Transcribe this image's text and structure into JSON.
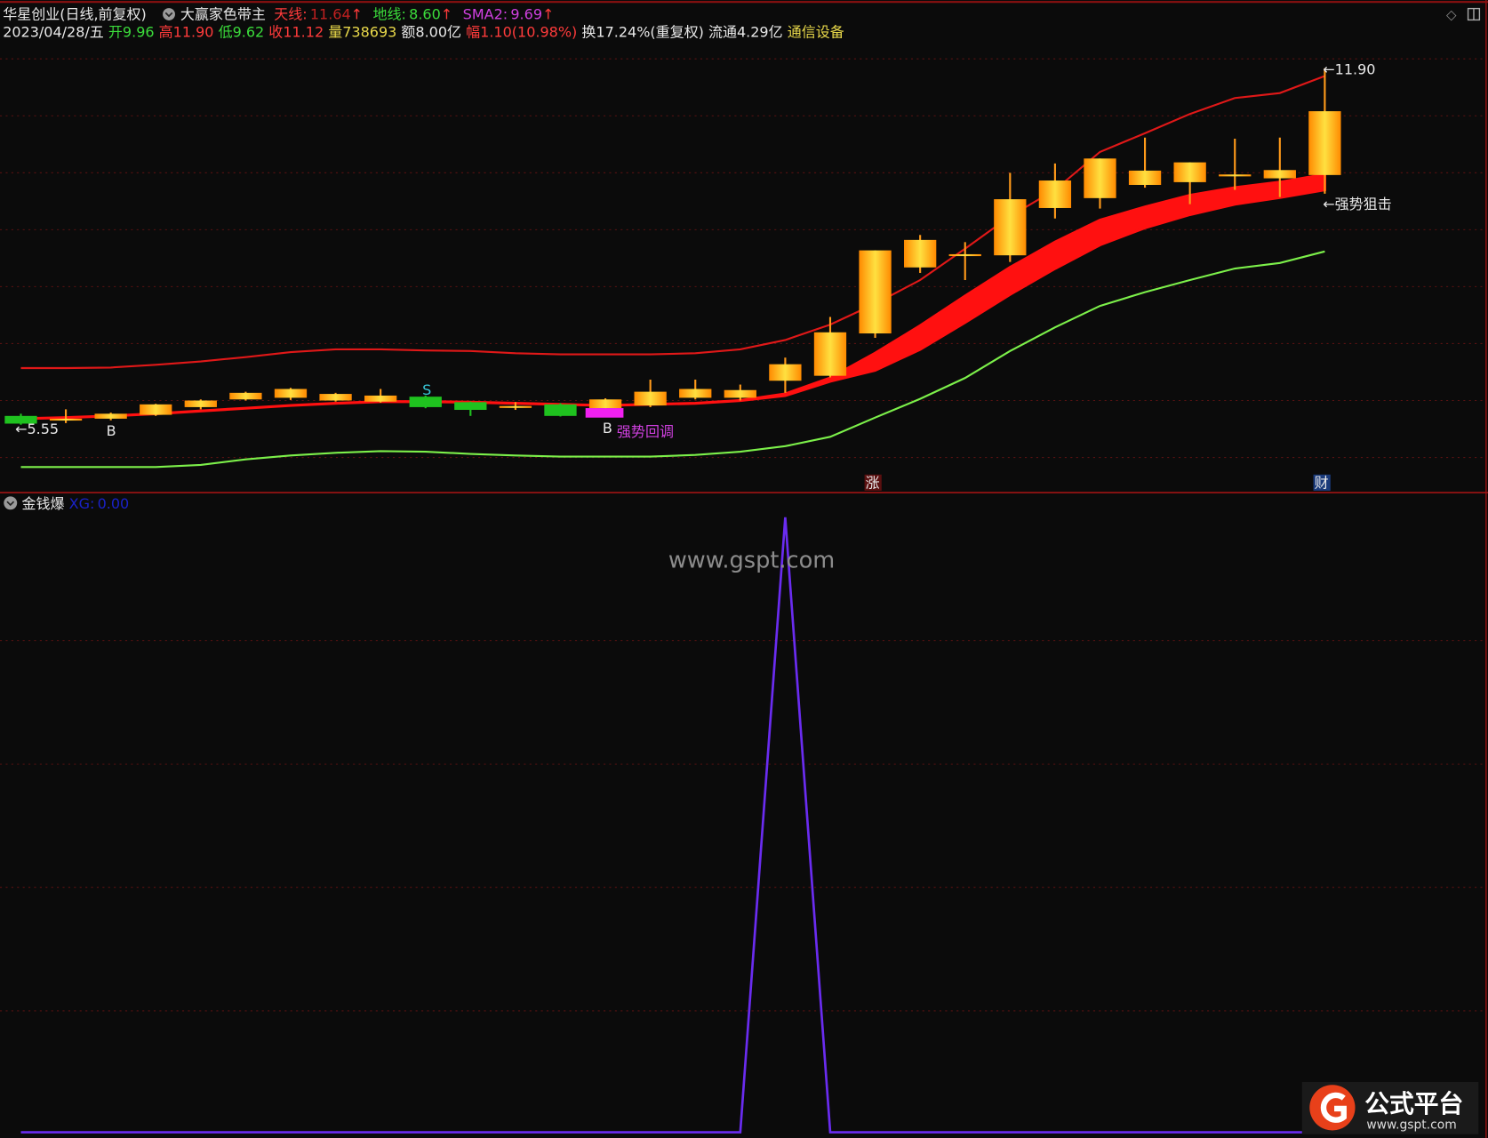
{
  "header": {
    "stock_name": "华星创业",
    "period": "(日线,前复权)",
    "indicator_name": "大赢家色带主",
    "tianxian_label": "天线:",
    "tianxian_value": "11.64",
    "dixian_label": "地线:",
    "dixian_value": "8.60",
    "sma2_label": "SMA2:",
    "sma2_value": "9.69",
    "up_arrow": "↑",
    "date": "2023/04/28/五",
    "open_label": "开",
    "open": "9.96",
    "high_label": "高",
    "high": "11.90",
    "low_label": "低",
    "low": "9.62",
    "close_label": "收",
    "close": "11.12",
    "volume_label": "量",
    "volume": "738693",
    "amount": "额8.00亿",
    "change_label": "幅",
    "change": "1.10(10.98%)",
    "turnover": "换17.24%(重复权)",
    "float_cap": "流通4.29亿",
    "sector": "通信设备"
  },
  "sub_panel": {
    "title": "金钱爆",
    "xg_label": "XG:",
    "xg_value": "0.00"
  },
  "annotations": {
    "low_marker": "←5.55",
    "high_marker": "←11.90",
    "buy1": "B",
    "buy2": "B",
    "sell": "S",
    "pullback": "强势回调",
    "snipe": "←强势狙击",
    "zhang": "涨",
    "cai": "财"
  },
  "watermark": "www.gspt.com",
  "logo": {
    "name": "公式平台",
    "url_text": "www.gspt.com"
  },
  "colors": {
    "up": "#ff9a1a",
    "down": "#1fc21f",
    "tianxian": "#e01818",
    "dixian": "#7cf04a",
    "ribbon": "#ff1010",
    "xg": "#6a2cf0",
    "bg": "#0b0b0b"
  },
  "chart_data": {
    "type": "candlestick",
    "candles": [
      {
        "o": 5.58,
        "h": 5.62,
        "l": 5.42,
        "c": 5.44
      },
      {
        "o": 5.53,
        "h": 5.7,
        "l": 5.45,
        "c": 5.53
      },
      {
        "o": 5.53,
        "h": 5.64,
        "l": 5.5,
        "c": 5.62
      },
      {
        "o": 5.6,
        "h": 5.8,
        "l": 5.58,
        "c": 5.79
      },
      {
        "o": 5.74,
        "h": 5.88,
        "l": 5.7,
        "c": 5.86
      },
      {
        "o": 5.88,
        "h": 6.02,
        "l": 5.86,
        "c": 6.0
      },
      {
        "o": 5.91,
        "h": 6.09,
        "l": 5.87,
        "c": 6.07
      },
      {
        "o": 5.86,
        "h": 6.0,
        "l": 5.84,
        "c": 5.98
      },
      {
        "o": 5.84,
        "h": 6.07,
        "l": 5.82,
        "c": 5.95
      },
      {
        "o": 5.93,
        "h": 5.95,
        "l": 5.72,
        "c": 5.74
      },
      {
        "o": 5.83,
        "h": 5.84,
        "l": 5.58,
        "c": 5.69
      },
      {
        "o": 5.76,
        "h": 5.83,
        "l": 5.69,
        "c": 5.76
      },
      {
        "o": 5.79,
        "h": 5.81,
        "l": 5.57,
        "c": 5.58
      },
      {
        "o": 5.72,
        "h": 5.9,
        "l": 5.7,
        "c": 5.88
      },
      {
        "o": 5.77,
        "h": 6.24,
        "l": 5.74,
        "c": 6.02
      },
      {
        "o": 5.91,
        "h": 6.24,
        "l": 5.88,
        "c": 6.07
      },
      {
        "o": 5.91,
        "h": 6.15,
        "l": 5.86,
        "c": 6.05
      },
      {
        "o": 6.22,
        "h": 6.64,
        "l": 6.0,
        "c": 6.52
      },
      {
        "o": 6.31,
        "h": 7.38,
        "l": 6.28,
        "c": 7.1
      },
      {
        "o": 7.08,
        "h": 8.59,
        "l": 7.0,
        "c": 8.59
      },
      {
        "o": 8.28,
        "h": 8.87,
        "l": 8.18,
        "c": 8.78
      },
      {
        "o": 8.52,
        "h": 8.74,
        "l": 8.05,
        "c": 8.52
      },
      {
        "o": 8.5,
        "h": 10.0,
        "l": 8.38,
        "c": 9.52
      },
      {
        "o": 9.36,
        "h": 10.17,
        "l": 9.17,
        "c": 9.86
      },
      {
        "o": 9.54,
        "h": 10.26,
        "l": 9.35,
        "c": 10.26
      },
      {
        "o": 9.78,
        "h": 10.64,
        "l": 9.73,
        "c": 10.04
      },
      {
        "o": 9.83,
        "h": 10.19,
        "l": 9.43,
        "c": 10.19
      },
      {
        "o": 9.97,
        "h": 10.62,
        "l": 9.69,
        "c": 9.97
      },
      {
        "o": 9.9,
        "h": 10.64,
        "l": 9.56,
        "c": 10.05
      },
      {
        "o": 9.96,
        "h": 11.9,
        "l": 9.62,
        "c": 11.12
      }
    ],
    "tianxian": [
      6.45,
      6.45,
      6.46,
      6.51,
      6.57,
      6.65,
      6.74,
      6.79,
      6.79,
      6.77,
      6.76,
      6.72,
      6.7,
      6.7,
      6.7,
      6.72,
      6.79,
      6.96,
      7.24,
      7.62,
      8.05,
      8.62,
      9.21,
      9.69,
      10.38,
      10.72,
      11.07,
      11.36,
      11.45,
      11.76
    ],
    "dixian": [
      4.65,
      4.65,
      4.65,
      4.65,
      4.69,
      4.79,
      4.86,
      4.91,
      4.94,
      4.93,
      4.89,
      4.86,
      4.84,
      4.84,
      4.84,
      4.87,
      4.93,
      5.03,
      5.2,
      5.55,
      5.89,
      6.27,
      6.76,
      7.19,
      7.58,
      7.83,
      8.05,
      8.26,
      8.36,
      8.57
    ],
    "ribbon_top": [
      5.53,
      5.55,
      5.58,
      5.62,
      5.67,
      5.72,
      5.77,
      5.81,
      5.84,
      5.84,
      5.83,
      5.81,
      5.79,
      5.77,
      5.79,
      5.81,
      5.86,
      5.98,
      6.27,
      6.72,
      7.22,
      7.76,
      8.28,
      8.74,
      9.14,
      9.38,
      9.59,
      9.73,
      9.83,
      9.97
    ],
    "ribbon_bottom": [
      5.53,
      5.55,
      5.58,
      5.62,
      5.67,
      5.72,
      5.77,
      5.81,
      5.84,
      5.84,
      5.83,
      5.81,
      5.79,
      5.77,
      5.79,
      5.81,
      5.86,
      5.95,
      6.21,
      6.41,
      6.79,
      7.28,
      7.79,
      8.26,
      8.69,
      9.0,
      9.24,
      9.43,
      9.55,
      9.69
    ],
    "xg": [
      0,
      0,
      0,
      0,
      0,
      0,
      0,
      0,
      0,
      0,
      0,
      0,
      0,
      0,
      0,
      0,
      0,
      1,
      0,
      0,
      0,
      0,
      0,
      0,
      0,
      0,
      0,
      0,
      0,
      0
    ]
  }
}
